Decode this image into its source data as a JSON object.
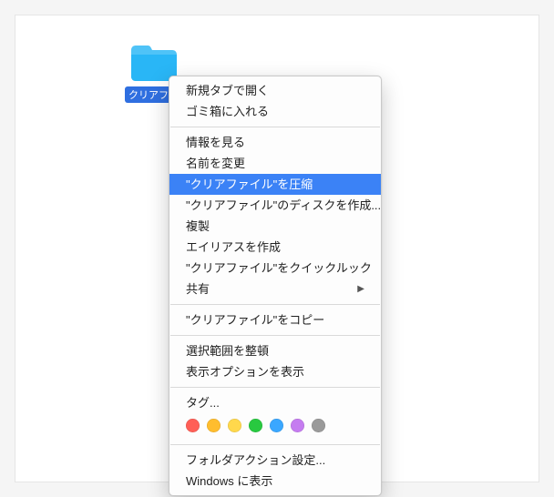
{
  "folder": {
    "name": "クリアファ…",
    "selected": true
  },
  "menu": {
    "groups": [
      [
        {
          "id": "open-new-tab",
          "label": "新規タブで開く"
        },
        {
          "id": "move-to-trash",
          "label": "ゴミ箱に入れる"
        }
      ],
      [
        {
          "id": "get-info",
          "label": "情報を見る"
        },
        {
          "id": "rename",
          "label": "名前を変更"
        },
        {
          "id": "compress",
          "label": "\"クリアファイル\"を圧縮",
          "highlighted": true
        },
        {
          "id": "burn-disk",
          "label": "\"クリアファイル\"のディスクを作成..."
        },
        {
          "id": "duplicate",
          "label": "複製"
        },
        {
          "id": "make-alias",
          "label": "エイリアスを作成"
        },
        {
          "id": "quicklook",
          "label": "\"クリアファイル\"をクイックルック"
        },
        {
          "id": "share",
          "label": "共有",
          "submenu": true
        }
      ],
      [
        {
          "id": "copy",
          "label": "\"クリアファイル\"をコピー"
        }
      ],
      [
        {
          "id": "arrange-selection",
          "label": "選択範囲を整頓"
        },
        {
          "id": "view-options",
          "label": "表示オプションを表示"
        }
      ],
      [
        {
          "id": "tags-label",
          "label": "タグ..."
        }
      ],
      [
        {
          "id": "folder-actions",
          "label": "フォルダアクション設定..."
        },
        {
          "id": "show-in-windows",
          "label": "Windows に表示"
        }
      ]
    ],
    "tagColors": [
      "#ff5f57",
      "#ffbd2e",
      "#ffd84c",
      "#28c940",
      "#3aa7ff",
      "#c57cf0",
      "#9a9a9a"
    ]
  }
}
